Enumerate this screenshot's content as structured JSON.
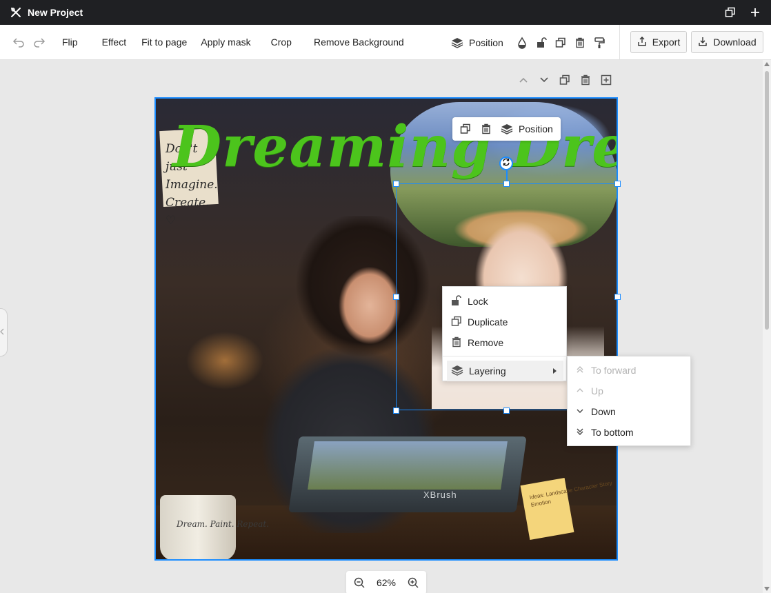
{
  "titlebar": {
    "title": "New Project",
    "icons": [
      "tools-icon",
      "duplicate-window-icon",
      "plus-icon"
    ]
  },
  "toolbar": {
    "items": [
      "Flip",
      "Effect",
      "Fit to page",
      "Apply mask",
      "Crop",
      "Remove Background"
    ],
    "position_label": "Position",
    "export_label": "Export",
    "download_label": "Download"
  },
  "artwork": {
    "title": "Dreaming Dreamer!",
    "note_text": "Don't just Imagine. Create. ♡",
    "tablet_brand": "XBrush",
    "mug_text": "Dream. Paint. Repeat.",
    "sticky_text": "Ideas: Landscape Character Story Emotion"
  },
  "mini_toolbar": {
    "position_label": "Position"
  },
  "context_menu": {
    "items": [
      {
        "label": "Lock",
        "icon": "lock-open-icon"
      },
      {
        "label": "Duplicate",
        "icon": "duplicate-icon"
      },
      {
        "label": "Remove",
        "icon": "trash-icon"
      },
      {
        "label": "Layering",
        "icon": "layers-icon"
      }
    ]
  },
  "submenu": {
    "items": [
      {
        "label": "To forward",
        "icon": "double-chevron-up-icon",
        "disabled": true
      },
      {
        "label": "Up",
        "icon": "chevron-up-icon",
        "disabled": true
      },
      {
        "label": "Down",
        "icon": "chevron-down-icon",
        "disabled": false
      },
      {
        "label": "To bottom",
        "icon": "double-chevron-down-icon",
        "disabled": false
      }
    ]
  },
  "zoom": {
    "value": "62%"
  },
  "colors": {
    "accent": "#1a8cff",
    "title_green": "#4cc41c",
    "titlebar_bg": "#1f2023"
  }
}
